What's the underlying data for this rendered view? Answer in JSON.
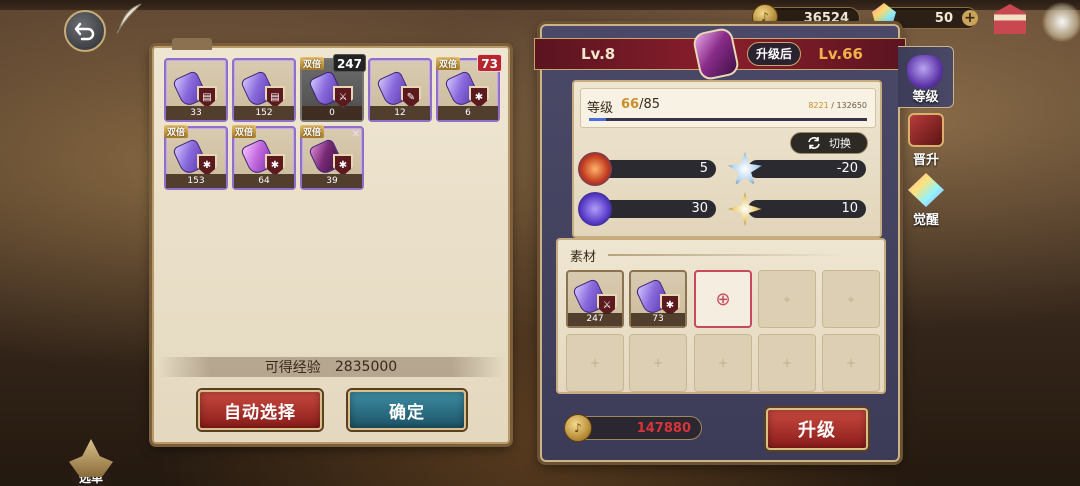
{
  "top_bar": {
    "back_icon": "back-arrow-icon",
    "gold_amount": "36524",
    "crystal_amount": "50",
    "plus_label": "+"
  },
  "left_panel": {
    "items": [
      {
        "count": "33",
        "double": "",
        "picked": "",
        "style": "purple",
        "emblem": "book"
      },
      {
        "count": "152",
        "double": "",
        "picked": "",
        "style": "purple",
        "emblem": "book"
      },
      {
        "count": "0",
        "double": "双倍",
        "picked": "247",
        "style": "selected",
        "emblem": "sword"
      },
      {
        "count": "12",
        "double": "",
        "picked": "",
        "style": "purple",
        "emblem": "quill"
      },
      {
        "count": "6",
        "double": "双倍",
        "picked": "73",
        "style": "purple",
        "emblem": "star"
      },
      {
        "count": "153",
        "double": "双倍",
        "picked": "",
        "style": "purple",
        "emblem": "star"
      },
      {
        "count": "64",
        "double": "双倍",
        "picked": "",
        "style": "pink",
        "emblem": "star"
      },
      {
        "count": "39",
        "double": "双倍",
        "picked": "",
        "style": "dark",
        "emblem": "star"
      }
    ],
    "exp_label": "可得经验",
    "exp_value": "2835000",
    "auto_select_label": "自动选择",
    "confirm_label": "确定"
  },
  "right_panel": {
    "current_level": "Lv.8",
    "after_label": "升级后",
    "next_level": "Lv.66",
    "level_label": "等级",
    "level_new": "66",
    "level_max": "/85",
    "exp_current": "8221",
    "exp_total": " / 132650",
    "exp_fraction": 0.062,
    "switch_label": "切换",
    "stats": [
      {
        "icon": "fire-icon",
        "value": "5"
      },
      {
        "icon": "ice-icon",
        "value": "-20"
      },
      {
        "icon": "shadow-icon",
        "value": "30"
      },
      {
        "icon": "lightning-icon",
        "value": "10"
      }
    ],
    "materials_label": "素材",
    "materials": [
      {
        "count": "247"
      },
      {
        "count": "73"
      }
    ],
    "cost_value": "147880",
    "upgrade_label": "升级"
  },
  "side_tabs": [
    {
      "label": "等级",
      "icon": "potion-icon",
      "active": true
    },
    {
      "label": "晋升",
      "icon": "book-icon",
      "active": false
    },
    {
      "label": "觉醒",
      "icon": "gem-icon",
      "active": false
    }
  ],
  "menu": {
    "label": "选单"
  }
}
